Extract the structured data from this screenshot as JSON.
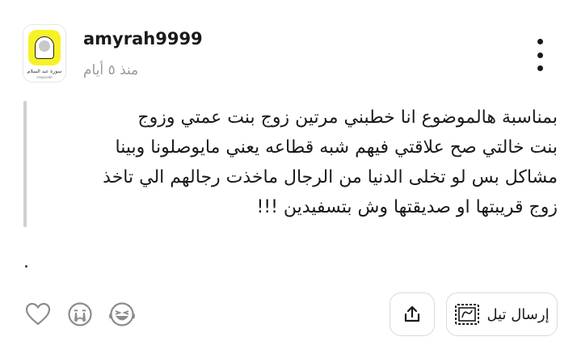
{
  "post": {
    "author": {
      "username": "amyrah9999",
      "avatar_caption": "سورة عبد السلام",
      "avatar_subcaption": "snapcode"
    },
    "time": "منذ ٥ أيام",
    "lines": [
      "بمناسبة هالموضوع انا خطبني مرتين زوج بنت عمتي وزوج",
      "بنت خالتي صح علاقتي فيهم شبه قطاعه يعني مايوصلونا وبينا",
      "مشاكل بس لو تخلى الدنيا من الرجال ماخذت رجالهم الي تاخذ",
      "زوج قريبتها او صديقتها وش بتسفيدين !!!"
    ],
    "trailing": "."
  },
  "actions": {
    "send_tip_label": "إرسال تيل",
    "icons": [
      "heart-icon",
      "crying-face-icon",
      "laughing-face-icon",
      "share-icon",
      "tip-stamp-icon",
      "more-vertical-icon"
    ]
  },
  "colors": {
    "text": "#1a1a1a",
    "muted": "#9a9a9a",
    "quote_bar": "#d0d0d0",
    "border": "#d9d9d9",
    "snap_yellow": "#f7f226"
  }
}
